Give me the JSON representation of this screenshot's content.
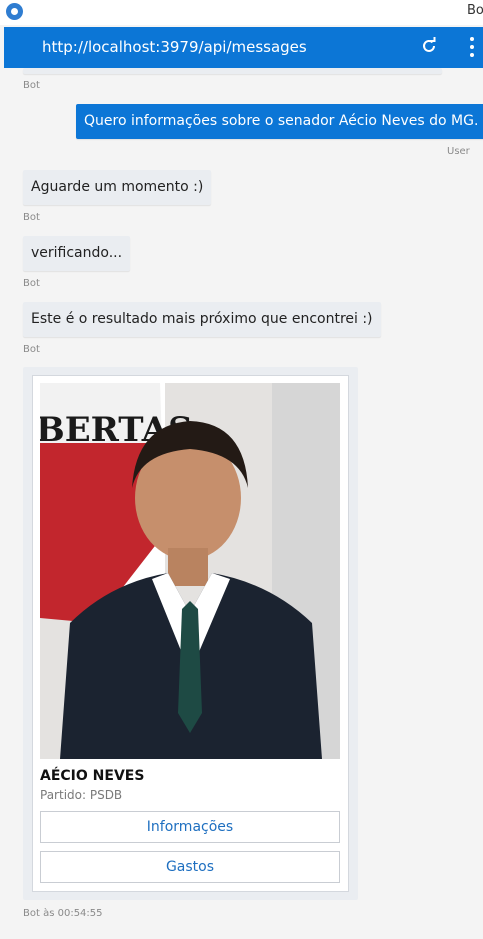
{
  "window": {
    "title": "Bo"
  },
  "address_bar": {
    "url": "http://localhost:3979/api/messages",
    "refresh_icon": "refresh-icon",
    "menu_icon": "more-vertical-icon"
  },
  "messages": [
    {
      "sender": "Bot",
      "text": ""
    },
    {
      "sender": "User",
      "text": "Quero informações sobre o senador Aécio Neves do MG."
    },
    {
      "sender": "Bot",
      "text": "Aguarde um momento :)"
    },
    {
      "sender": "Bot",
      "text": "verificando..."
    },
    {
      "sender": "Bot",
      "text": "Este é o resultado mais próximo que encontrei :)"
    }
  ],
  "card": {
    "image_banner_text": "BERTAS",
    "title": "AÉCIO NEVES",
    "subtitle": "Partido: PSDB",
    "buttons": [
      "Informações",
      "Gastos"
    ],
    "timestamp": "Bot às 00:54:55"
  },
  "colors": {
    "accent": "#0c76d6",
    "bot_bubble": "#eaedf1",
    "background": "#f4f4f4"
  }
}
